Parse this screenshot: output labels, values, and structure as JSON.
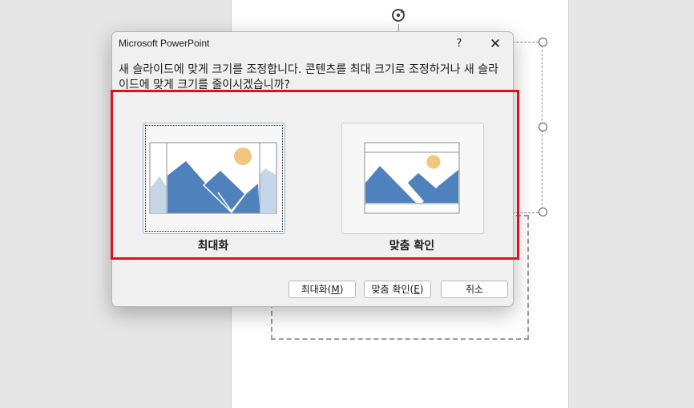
{
  "dialog": {
    "title": "Microsoft PowerPoint",
    "help_label": "?",
    "close_label": "✕",
    "message": "새 슬라이드에 맞게 크기를 조정합니다. 콘텐츠를 최대 크기로 조정하거나 새 슬라이드에 맞게 크기를 줄이시겠습니까?",
    "options": [
      {
        "label": "최대화",
        "selected": true
      },
      {
        "label": "맞춤 확인",
        "selected": false
      }
    ],
    "buttons": {
      "maximize_label": "최대화",
      "maximize_key": "M",
      "fit_label": "맞춤 확인",
      "fit_key": "E",
      "cancel_label": "취소"
    }
  },
  "colors": {
    "mountain": "#4f81bd",
    "mountain_faded": "#c5d6e8",
    "sun": "#f0c77d",
    "highlight": "#e3101a"
  }
}
